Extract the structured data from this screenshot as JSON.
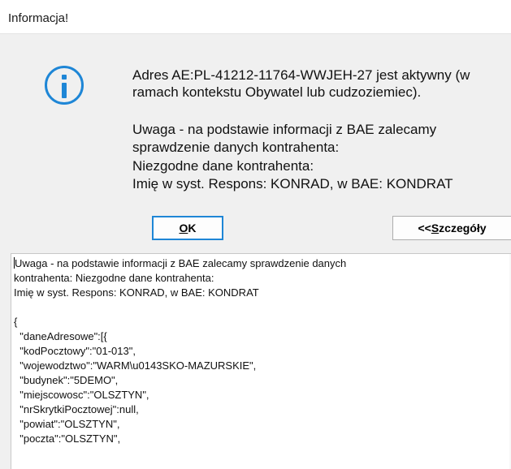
{
  "window": {
    "title": "Informacja!"
  },
  "message": {
    "icon": "info-icon",
    "lines": [
      "Adres AE:PL-41212-11764-WWJEH-27 jest aktywny (w",
      "ramach kontekstu Obywatel lub cudzoziemiec).",
      "",
      "Uwaga - na podstawie informacji z BAE zalecamy",
      "sprawdzenie danych kontrahenta:",
      "Niezgodne dane kontrahenta:",
      "Imię w syst. Respons: KONRAD, w BAE: KONDRAT"
    ]
  },
  "buttons": {
    "ok": {
      "prefix": "",
      "accel": "O",
      "suffix": "K"
    },
    "details": {
      "prefix": "<<",
      "accel": "S",
      "suffix": "zczegóły"
    }
  },
  "details": {
    "lines": [
      "Uwaga - na podstawie informacji z BAE zalecamy sprawdzenie danych",
      "kontrahenta: Niezgodne dane kontrahenta:",
      "Imię w syst. Respons: KONRAD, w BAE: KONDRAT",
      "",
      "{",
      "  \"daneAdresowe\":[{",
      "  \"kodPocztowy\":\"01-013\",",
      "  \"wojewodztwo\":\"WARM\\u0143SKO-MAZURSKIE\",",
      "  \"budynek\":\"5DEMO\",",
      "  \"miejscowosc\":\"OLSZTYN\",",
      "  \"nrSkrytkiPocztowej\":null,",
      "  \"powiat\":\"OLSZTYN\",",
      "  \"poczta\":\"OLSZTYN\","
    ]
  }
}
